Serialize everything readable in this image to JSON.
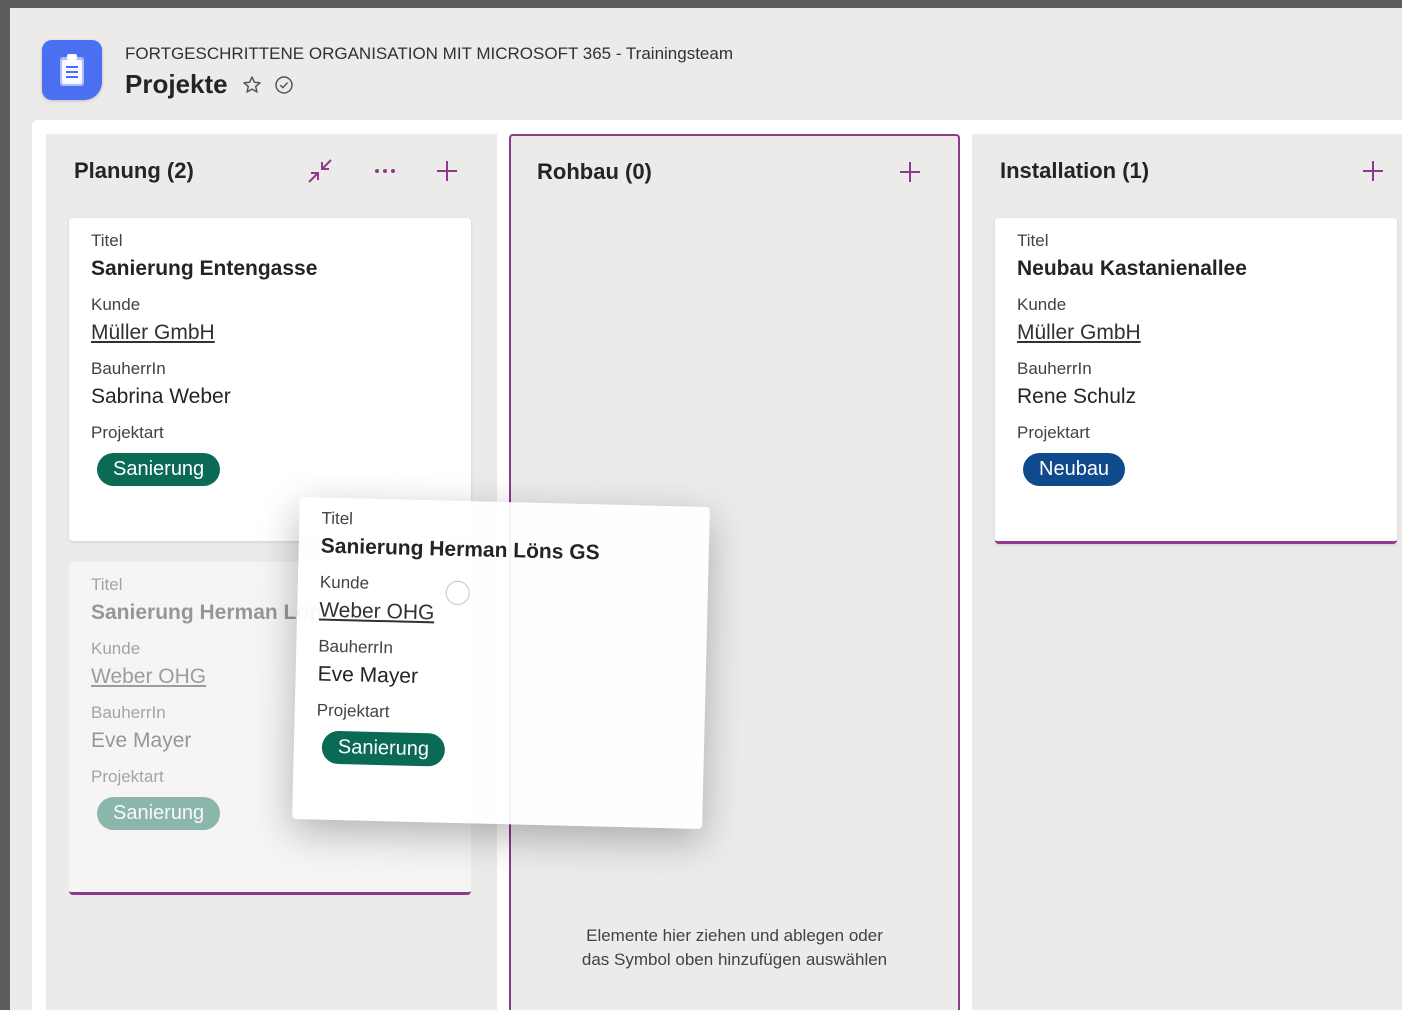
{
  "header": {
    "subtitle": "FORTGESCHRITTENE ORGANISATION MIT MICROSOFT 365 - Trainingsteam",
    "title": "Projekte"
  },
  "colors": {
    "accent": "#8b3a8c",
    "sanierung": "#0b6a53",
    "neubau": "#0f4a8c",
    "logo": "#4a6ff0"
  },
  "columns": [
    {
      "title": "Planung (2)",
      "cards": [
        {
          "title_label": "Titel",
          "title": "Sanierung Entengasse",
          "kunde_label": "Kunde",
          "kunde": "Müller GmbH",
          "bauherr_label": "BauherrIn",
          "bauherr": "Sabrina Weber",
          "projektart_label": "Projektart",
          "projektart": "Sanierung"
        },
        {
          "title_label": "Titel",
          "title": "Sanierung Herman Löns GS",
          "kunde_label": "Kunde",
          "kunde": "Weber OHG",
          "bauherr_label": "BauherrIn",
          "bauherr": "Eve Mayer",
          "projektart_label": "Projektart",
          "projektart": "Sanierung"
        }
      ]
    },
    {
      "title": "Rohbau (0)",
      "empty_line1": "Elemente hier ziehen und ablegen oder",
      "empty_line2": "das Symbol oben hinzufügen auswählen"
    },
    {
      "title": "Installation (1)",
      "cards": [
        {
          "title_label": "Titel",
          "title": "Neubau Kastanienallee",
          "kunde_label": "Kunde",
          "kunde": "Müller GmbH",
          "bauherr_label": "BauherrIn",
          "bauherr": "Rene Schulz",
          "projektart_label": "Projektart",
          "projektart": "Neubau"
        }
      ]
    }
  ],
  "dragging": {
    "title_label": "Titel",
    "title": "Sanierung Herman Löns GS",
    "kunde_label": "Kunde",
    "kunde": "Weber OHG",
    "bauherr_label": "BauherrIn",
    "bauherr": "Eve Mayer",
    "projektart_label": "Projektart",
    "projektart": "Sanierung"
  },
  "icons": [
    "clipboard-icon",
    "star-icon",
    "check-circle-icon",
    "collapse-icon",
    "more-icon",
    "add-icon"
  ]
}
